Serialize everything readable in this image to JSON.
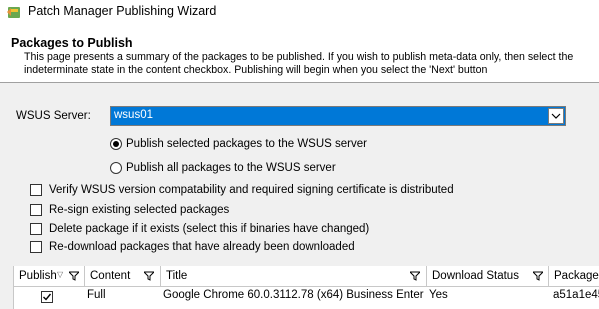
{
  "window": {
    "title": "Patch Manager Publishing Wizard"
  },
  "header": {
    "title": "Packages to Publish",
    "description": "This page presents a summary of the packages to be published. If you wish to publish meta-data only, then select the indeterminate state in the content checkbox. Publishing will begin when you select the 'Next' button"
  },
  "server": {
    "label": "WSUS Server:",
    "selected": "wsus01"
  },
  "publish_options": [
    {
      "label": "Publish selected packages to the WSUS server",
      "checked": true
    },
    {
      "label": "Publish all packages to the WSUS server",
      "checked": false
    }
  ],
  "checkboxes": [
    {
      "label": "Verify WSUS version compatability and required signing certificate is distributed",
      "checked": false
    },
    {
      "label": "Re-sign existing selected packages",
      "checked": false
    },
    {
      "label": "Delete package if it exists (select this if binaries have changed)",
      "checked": false
    },
    {
      "label": "Re-download packages that have already been downloaded",
      "checked": false
    }
  ],
  "grid": {
    "columns": [
      "Publish",
      "Content",
      "Title",
      "Download Status",
      "Package"
    ],
    "rows": [
      {
        "publish": true,
        "content": "Full",
        "title": "Google Chrome 60.0.3112.78 (x64) Business Enter",
        "download_status": "Yes",
        "package": "a51a1e45"
      }
    ]
  }
}
